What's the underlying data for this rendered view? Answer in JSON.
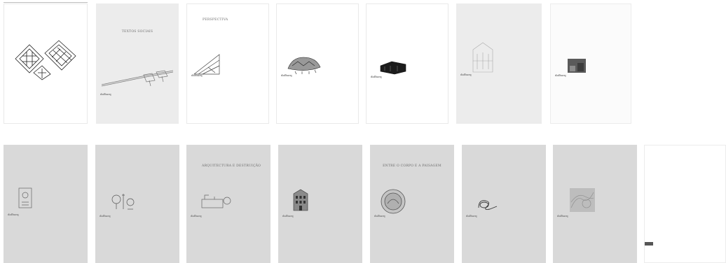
{
  "covers_top": [
    {
      "author": "",
      "title": "",
      "subtitle": "",
      "publisher": "",
      "footer": ""
    },
    {
      "author": "",
      "title": "TEXTOS SOCIAIS",
      "subtitle": "",
      "publisher": "dafbarq",
      "footer": ""
    },
    {
      "author": "",
      "title": "PERSPECTIVA",
      "subtitle": "",
      "publisher": "dafbarq",
      "footer": ""
    },
    {
      "author": "",
      "title": "",
      "subtitle": "",
      "publisher": "dafbarq",
      "footer": ""
    },
    {
      "author": "",
      "title": "",
      "subtitle": "",
      "publisher": "dafbarq",
      "footer": ""
    },
    {
      "author": "",
      "title": "",
      "subtitle": "",
      "publisher": "dafbarq",
      "footer": ""
    },
    {
      "author": "",
      "title": "",
      "subtitle": "",
      "publisher": "dafbarq",
      "footer": ""
    }
  ],
  "covers_bottom": [
    {
      "author": "",
      "title": "",
      "subtitle": "",
      "publisher": "dafbarq",
      "footer": ""
    },
    {
      "author": "",
      "title": "",
      "subtitle": "",
      "publisher": "dafbarq",
      "footer": ""
    },
    {
      "author": "",
      "title": "ARQUITECTURA E DESTRUIÇÃO",
      "subtitle": "",
      "publisher": "dafbarq",
      "footer": ""
    },
    {
      "author": "",
      "title": "",
      "subtitle": "",
      "publisher": "dafbarq",
      "footer": ""
    },
    {
      "author": "",
      "title": "ENTRE O CORPO E A PAISAGEM",
      "subtitle": "",
      "publisher": "dafbarq",
      "footer": ""
    },
    {
      "author": "",
      "title": "",
      "subtitle": "",
      "publisher": "dafbarq",
      "footer": ""
    },
    {
      "author": "",
      "title": "",
      "subtitle": "",
      "publisher": "dafbarq",
      "footer": ""
    }
  ],
  "document_page": {
    "heading": "",
    "body": "",
    "footer": ""
  }
}
